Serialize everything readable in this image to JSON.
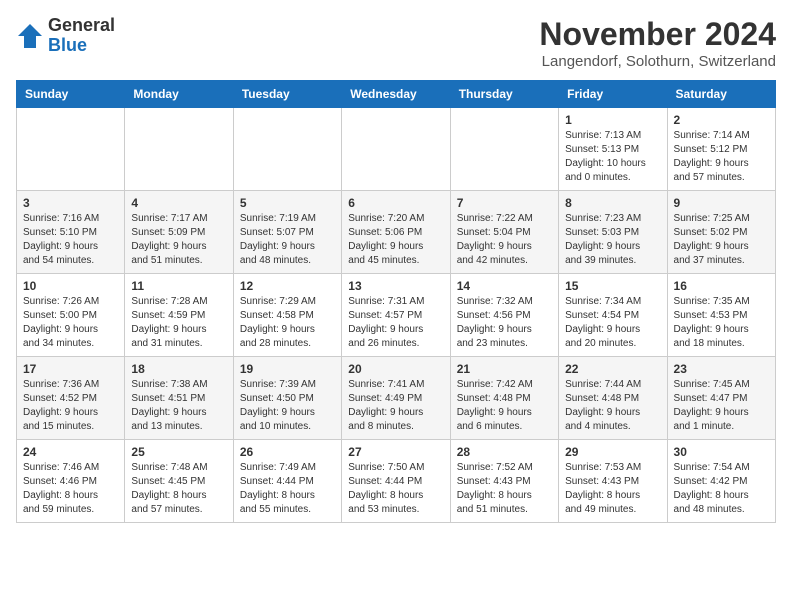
{
  "logo": {
    "general": "General",
    "blue": "Blue"
  },
  "title": "November 2024",
  "location": "Langendorf, Solothurn, Switzerland",
  "weekdays": [
    "Sunday",
    "Monday",
    "Tuesday",
    "Wednesday",
    "Thursday",
    "Friday",
    "Saturday"
  ],
  "weeks": [
    [
      {
        "day": "",
        "details": ""
      },
      {
        "day": "",
        "details": ""
      },
      {
        "day": "",
        "details": ""
      },
      {
        "day": "",
        "details": ""
      },
      {
        "day": "",
        "details": ""
      },
      {
        "day": "1",
        "details": "Sunrise: 7:13 AM\nSunset: 5:13 PM\nDaylight: 10 hours\nand 0 minutes."
      },
      {
        "day": "2",
        "details": "Sunrise: 7:14 AM\nSunset: 5:12 PM\nDaylight: 9 hours\nand 57 minutes."
      }
    ],
    [
      {
        "day": "3",
        "details": "Sunrise: 7:16 AM\nSunset: 5:10 PM\nDaylight: 9 hours\nand 54 minutes."
      },
      {
        "day": "4",
        "details": "Sunrise: 7:17 AM\nSunset: 5:09 PM\nDaylight: 9 hours\nand 51 minutes."
      },
      {
        "day": "5",
        "details": "Sunrise: 7:19 AM\nSunset: 5:07 PM\nDaylight: 9 hours\nand 48 minutes."
      },
      {
        "day": "6",
        "details": "Sunrise: 7:20 AM\nSunset: 5:06 PM\nDaylight: 9 hours\nand 45 minutes."
      },
      {
        "day": "7",
        "details": "Sunrise: 7:22 AM\nSunset: 5:04 PM\nDaylight: 9 hours\nand 42 minutes."
      },
      {
        "day": "8",
        "details": "Sunrise: 7:23 AM\nSunset: 5:03 PM\nDaylight: 9 hours\nand 39 minutes."
      },
      {
        "day": "9",
        "details": "Sunrise: 7:25 AM\nSunset: 5:02 PM\nDaylight: 9 hours\nand 37 minutes."
      }
    ],
    [
      {
        "day": "10",
        "details": "Sunrise: 7:26 AM\nSunset: 5:00 PM\nDaylight: 9 hours\nand 34 minutes."
      },
      {
        "day": "11",
        "details": "Sunrise: 7:28 AM\nSunset: 4:59 PM\nDaylight: 9 hours\nand 31 minutes."
      },
      {
        "day": "12",
        "details": "Sunrise: 7:29 AM\nSunset: 4:58 PM\nDaylight: 9 hours\nand 28 minutes."
      },
      {
        "day": "13",
        "details": "Sunrise: 7:31 AM\nSunset: 4:57 PM\nDaylight: 9 hours\nand 26 minutes."
      },
      {
        "day": "14",
        "details": "Sunrise: 7:32 AM\nSunset: 4:56 PM\nDaylight: 9 hours\nand 23 minutes."
      },
      {
        "day": "15",
        "details": "Sunrise: 7:34 AM\nSunset: 4:54 PM\nDaylight: 9 hours\nand 20 minutes."
      },
      {
        "day": "16",
        "details": "Sunrise: 7:35 AM\nSunset: 4:53 PM\nDaylight: 9 hours\nand 18 minutes."
      }
    ],
    [
      {
        "day": "17",
        "details": "Sunrise: 7:36 AM\nSunset: 4:52 PM\nDaylight: 9 hours\nand 15 minutes."
      },
      {
        "day": "18",
        "details": "Sunrise: 7:38 AM\nSunset: 4:51 PM\nDaylight: 9 hours\nand 13 minutes."
      },
      {
        "day": "19",
        "details": "Sunrise: 7:39 AM\nSunset: 4:50 PM\nDaylight: 9 hours\nand 10 minutes."
      },
      {
        "day": "20",
        "details": "Sunrise: 7:41 AM\nSunset: 4:49 PM\nDaylight: 9 hours\nand 8 minutes."
      },
      {
        "day": "21",
        "details": "Sunrise: 7:42 AM\nSunset: 4:48 PM\nDaylight: 9 hours\nand 6 minutes."
      },
      {
        "day": "22",
        "details": "Sunrise: 7:44 AM\nSunset: 4:48 PM\nDaylight: 9 hours\nand 4 minutes."
      },
      {
        "day": "23",
        "details": "Sunrise: 7:45 AM\nSunset: 4:47 PM\nDaylight: 9 hours\nand 1 minute."
      }
    ],
    [
      {
        "day": "24",
        "details": "Sunrise: 7:46 AM\nSunset: 4:46 PM\nDaylight: 8 hours\nand 59 minutes."
      },
      {
        "day": "25",
        "details": "Sunrise: 7:48 AM\nSunset: 4:45 PM\nDaylight: 8 hours\nand 57 minutes."
      },
      {
        "day": "26",
        "details": "Sunrise: 7:49 AM\nSunset: 4:44 PM\nDaylight: 8 hours\nand 55 minutes."
      },
      {
        "day": "27",
        "details": "Sunrise: 7:50 AM\nSunset: 4:44 PM\nDaylight: 8 hours\nand 53 minutes."
      },
      {
        "day": "28",
        "details": "Sunrise: 7:52 AM\nSunset: 4:43 PM\nDaylight: 8 hours\nand 51 minutes."
      },
      {
        "day": "29",
        "details": "Sunrise: 7:53 AM\nSunset: 4:43 PM\nDaylight: 8 hours\nand 49 minutes."
      },
      {
        "day": "30",
        "details": "Sunrise: 7:54 AM\nSunset: 4:42 PM\nDaylight: 8 hours\nand 48 minutes."
      }
    ]
  ]
}
